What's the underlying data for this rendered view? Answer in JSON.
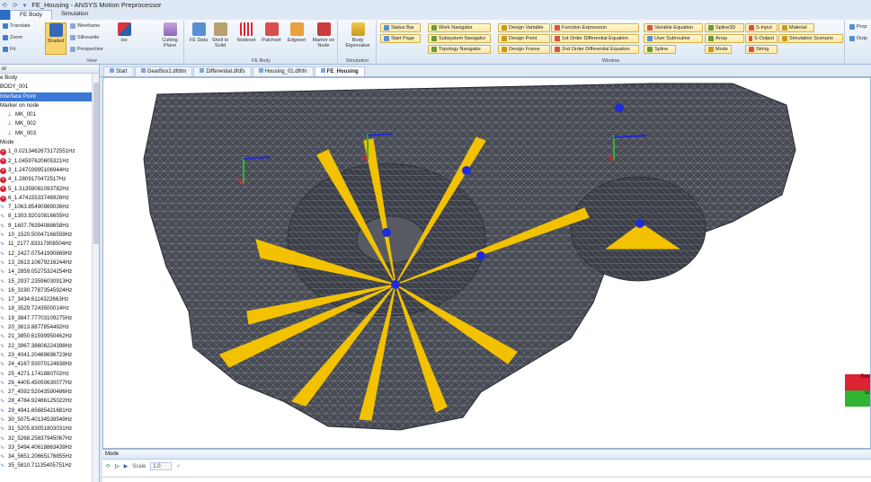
{
  "titlebar": {
    "title": "FE_Housing - ANSYS Motion Preprocessor",
    "quick_icons": [
      "⟲",
      "⟳",
      "▾"
    ]
  },
  "menu": {
    "file_label": "",
    "tabs": [
      "FE Body",
      "Simulation"
    ]
  },
  "ribbon": {
    "view": {
      "label": "View",
      "translate": "Translate",
      "zoom": "Zoom",
      "fit": "Fit",
      "shaded": "Shaded",
      "wireframe": "Wireframe",
      "silhouette": "Silhouette",
      "perspective": "Perspective",
      "iso": "Iso",
      "cutting_plane": "Cutting Plane"
    },
    "fe_body": {
      "label": "FE Body",
      "fe_data": "FE Data",
      "shell_to_solid": "Shell to Solid",
      "nodeset": "Nodeset",
      "patchset": "Patchset",
      "edgeset": "Edgeset",
      "marker_on_node": "Marker on Node"
    },
    "simulation": {
      "label": "Simulation",
      "body_eigenvalue": "Body Eigenvalue"
    },
    "window": {
      "label": "Window",
      "commands": [
        "Status Bar",
        "Work Navigator",
        "Design Variable",
        "Function Expression",
        "Variable Equation",
        "Spline3D",
        "S-Input",
        "Material",
        "Start Page",
        "Subsystem Navigator",
        "Design Point",
        "1st Order Differential Equation",
        "User Subroutine",
        "Array",
        "S-Output",
        "Simulation Scenario",
        "Topology Navigator",
        "Design Frame",
        "2nd Order Differential Equation",
        "Spline",
        "Mode",
        "String"
      ]
    },
    "extra": [
      "Prop",
      "Outp"
    ]
  },
  "tree": {
    "header": "or",
    "items": [
      {
        "label": "e Body",
        "kind": "plain"
      },
      {
        "label": "BODY_001",
        "kind": "plain"
      },
      {
        "label": "Interface Point",
        "kind": "selected"
      },
      {
        "label": "Marker on node",
        "kind": "plain"
      },
      {
        "label": "MK_001",
        "kind": "marker"
      },
      {
        "label": "MK_002",
        "kind": "marker"
      },
      {
        "label": "MK_003",
        "kind": "marker"
      },
      {
        "label": "Mode",
        "kind": "plain"
      },
      {
        "label": "1_0.0213462673172551Hz",
        "kind": "error"
      },
      {
        "label": "2_1.04597620605321Hz",
        "kind": "error"
      },
      {
        "label": "3_1.24703995106944Hz",
        "kind": "error"
      },
      {
        "label": "4_1.2809170472517Hz",
        "kind": "error"
      },
      {
        "label": "5_1.31359081093782Hz",
        "kind": "error"
      },
      {
        "label": "6_1.47415533746926Hz",
        "kind": "error"
      },
      {
        "label": "7_1063.85490989036Hz",
        "kind": "mode"
      },
      {
        "label": "8_1303.92010816655Hz",
        "kind": "mode"
      },
      {
        "label": "9_1607.76394088658Hz",
        "kind": "mode"
      },
      {
        "label": "10_1520.50047166559Hz",
        "kind": "mode"
      },
      {
        "label": "11_2177.83317908504Hz",
        "kind": "mode"
      },
      {
        "label": "12_2427.07541990869Hz",
        "kind": "mode"
      },
      {
        "label": "13_2613.10679216244Hz",
        "kind": "mode"
      },
      {
        "label": "14_2859.05275324254Hz",
        "kind": "mode"
      },
      {
        "label": "15_2937.23596030913Hz",
        "kind": "mode"
      },
      {
        "label": "16_3190.77873545924Hz",
        "kind": "mode"
      },
      {
        "label": "17_3434.6114322663Hz",
        "kind": "mode"
      },
      {
        "label": "18_3529.7243500014Hz",
        "kind": "mode"
      },
      {
        "label": "19_3847.77703109275Hz",
        "kind": "mode"
      },
      {
        "label": "20_3813.8877854492Hz",
        "kind": "mode"
      },
      {
        "label": "21_3850.61599950462Hz",
        "kind": "mode"
      },
      {
        "label": "22_3967.38606224398Hz",
        "kind": "mode"
      },
      {
        "label": "23_4041.20469696723Hz",
        "kind": "mode"
      },
      {
        "label": "24_4167.93070124838Hz",
        "kind": "mode"
      },
      {
        "label": "25_4271.1741880702Hz",
        "kind": "mode"
      },
      {
        "label": "26_4405.45050630077Hz",
        "kind": "mode"
      },
      {
        "label": "27_4592.52043590486Hz",
        "kind": "mode"
      },
      {
        "label": "28_4784.92466125022Hz",
        "kind": "mode"
      },
      {
        "label": "29_4941.65685421681Hz",
        "kind": "mode"
      },
      {
        "label": "30_5075.40134539549Hz",
        "kind": "mode"
      },
      {
        "label": "31_5205.83051803031Hz",
        "kind": "mode"
      },
      {
        "label": "32_5268.25837945067Hz",
        "kind": "mode"
      },
      {
        "label": "33_5494.40618863439Hz",
        "kind": "mode"
      },
      {
        "label": "34_5651.20665176855Hz",
        "kind": "mode"
      },
      {
        "label": "35_5810.71135405751Hz",
        "kind": "mode"
      }
    ]
  },
  "doctabs": [
    "Start",
    "GearBox1.dfdtm",
    "Differential.dfdfs",
    "Housing_01.dfhfn",
    "FE_Housing"
  ],
  "viewport": {
    "axis_labels": [
      "Rev",
      "sc"
    ]
  },
  "bottom": {
    "title": "Mode",
    "scale_label": "Scale",
    "scale_value": "1.0"
  },
  "colors": {
    "mesh": "#4a4d55",
    "spider": "#f2c200",
    "node_marker": "#1f2ad8",
    "selection": "#3a78d8"
  }
}
